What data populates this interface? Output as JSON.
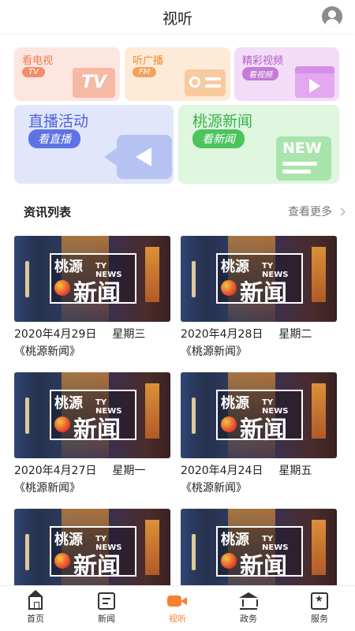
{
  "header": {
    "title": "视听"
  },
  "cards": {
    "tv": {
      "title": "看电视",
      "badge": "TV",
      "deco": "TV"
    },
    "fm": {
      "title": "听广播",
      "badge": "FM"
    },
    "video": {
      "title": "精彩视频",
      "badge": "看视频"
    },
    "live": {
      "title": "直播活动",
      "badge": "看直播"
    },
    "news": {
      "title": "桃源新闻",
      "badge": "看新闻",
      "deco": "NEW"
    }
  },
  "section": {
    "title": "资讯列表",
    "more": "查看更多"
  },
  "thumbnail_logo": {
    "cn_top": "桃源",
    "en": "TY NEWS",
    "cn_big": "新闻"
  },
  "items": [
    {
      "date": "2020年4月29日",
      "weekday": "星期三",
      "program": "《桃源新闻》"
    },
    {
      "date": "2020年4月28日",
      "weekday": "星期二",
      "program": "《桃源新闻》"
    },
    {
      "date": "2020年4月27日",
      "weekday": "星期一",
      "program": "《桃源新闻》"
    },
    {
      "date": "2020年4月24日",
      "weekday": "星期五",
      "program": "《桃源新闻》"
    },
    {
      "date": "",
      "weekday": "",
      "program": ""
    },
    {
      "date": "",
      "weekday": "",
      "program": ""
    }
  ],
  "nav": [
    {
      "label": "首页",
      "icon": "home-icon",
      "active": false
    },
    {
      "label": "新闻",
      "icon": "news-icon",
      "active": false
    },
    {
      "label": "视听",
      "icon": "video-camera-icon",
      "active": true
    },
    {
      "label": "政务",
      "icon": "government-icon",
      "active": false
    },
    {
      "label": "服务",
      "icon": "service-icon",
      "active": false
    }
  ],
  "colors": {
    "accent": "#f5812f"
  }
}
